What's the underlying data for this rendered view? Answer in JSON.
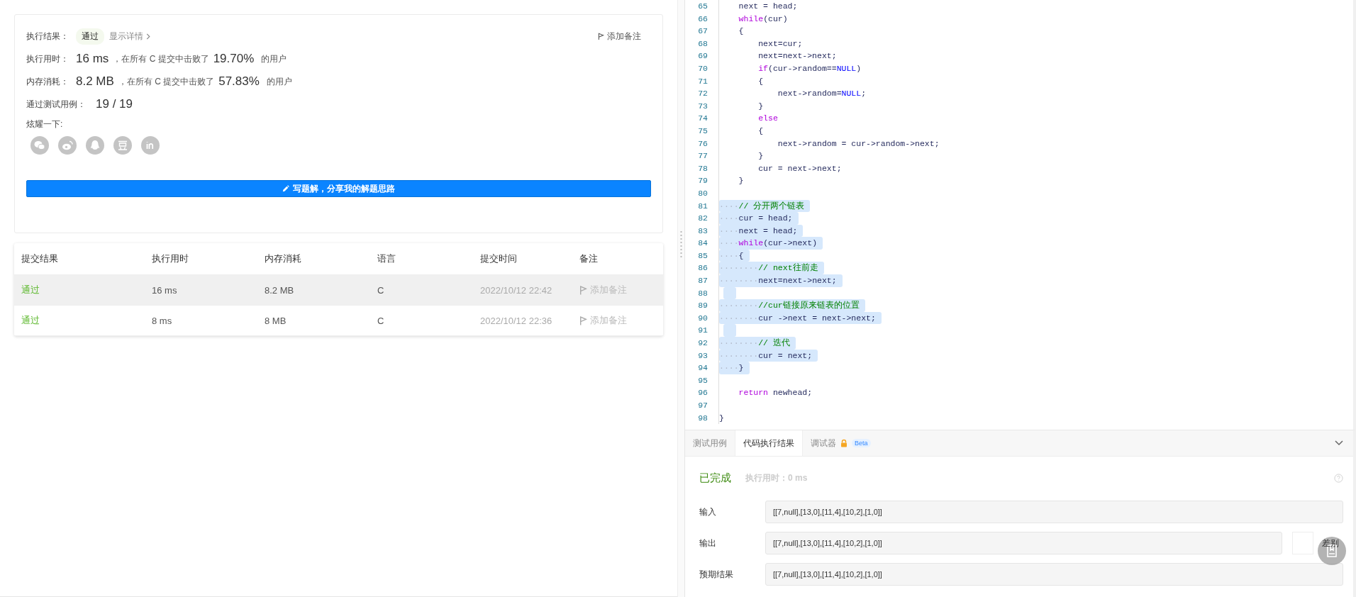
{
  "result": {
    "label": "执行结果：",
    "status": "通过",
    "details_link": "显示详情",
    "add_note": "添加备注"
  },
  "stats": [
    {
      "label": "执行用时：",
      "value": "16 ms",
      "note": "，在所有 C 提交中击败了",
      "percent": "19.70%",
      "suffix": "的用户"
    },
    {
      "label": "内存消耗：",
      "value": "8.2 MB",
      "note": "，在所有 C 提交中击败了",
      "percent": "57.83%",
      "suffix": "的用户"
    }
  ],
  "testcases": {
    "label": "通过测试用例：",
    "value": "19 / 19"
  },
  "share": {
    "label": "炫耀一下:"
  },
  "write_button": "写题解，分享我的解题思路",
  "submissions": {
    "columns": [
      "提交结果",
      "执行用时",
      "内存消耗",
      "语言",
      "提交时间",
      "备注"
    ],
    "rows": [
      {
        "status": "通过",
        "time": "16 ms",
        "memory": "8.2 MB",
        "language": "C",
        "submitted": "2022/10/12 22:42",
        "note": "添加备注",
        "selected": true
      },
      {
        "status": "通过",
        "time": "8 ms",
        "memory": "8 MB",
        "language": "C",
        "submitted": "2022/10/12 22:36",
        "note": "添加备注",
        "selected": false
      }
    ]
  },
  "editor": {
    "lines": [
      {
        "n": "65",
        "selected": false,
        "tokens": [
          {
            "t": "    next = head;",
            "kind": "plain"
          }
        ]
      },
      {
        "n": "66",
        "selected": false,
        "tokens": [
          {
            "t": "    while",
            "kind": "kw"
          },
          {
            "t": "(cur)",
            "kind": "plain"
          }
        ]
      },
      {
        "n": "67",
        "selected": false,
        "tokens": [
          {
            "t": "    {",
            "kind": "plain"
          }
        ]
      },
      {
        "n": "68",
        "selected": false,
        "tokens": [
          {
            "t": "        next=cur;",
            "kind": "plain"
          }
        ]
      },
      {
        "n": "69",
        "selected": false,
        "tokens": [
          {
            "t": "        next=next->next;",
            "kind": "plain"
          }
        ]
      },
      {
        "n": "70",
        "selected": false,
        "tokens": [
          {
            "t": "        if",
            "kind": "kw"
          },
          {
            "t": "(cur->random==",
            "kind": "plain"
          },
          {
            "t": "NULL",
            "kind": "const"
          },
          {
            "t": ")",
            "kind": "plain"
          }
        ]
      },
      {
        "n": "71",
        "selected": false,
        "tokens": [
          {
            "t": "        {",
            "kind": "plain"
          }
        ]
      },
      {
        "n": "72",
        "selected": false,
        "tokens": [
          {
            "t": "            next->random=",
            "kind": "plain"
          },
          {
            "t": "NULL",
            "kind": "const"
          },
          {
            "t": ";",
            "kind": "plain"
          }
        ]
      },
      {
        "n": "73",
        "selected": false,
        "tokens": [
          {
            "t": "        }",
            "kind": "plain"
          }
        ]
      },
      {
        "n": "74",
        "selected": false,
        "tokens": [
          {
            "t": "        else",
            "kind": "kw"
          }
        ]
      },
      {
        "n": "75",
        "selected": false,
        "tokens": [
          {
            "t": "        {",
            "kind": "plain"
          }
        ]
      },
      {
        "n": "76",
        "selected": false,
        "tokens": [
          {
            "t": "            next->random = cur->random->next;",
            "kind": "plain"
          }
        ]
      },
      {
        "n": "77",
        "selected": false,
        "tokens": [
          {
            "t": "        }",
            "kind": "plain"
          }
        ]
      },
      {
        "n": "78",
        "selected": false,
        "tokens": [
          {
            "t": "        cur = next->next;",
            "kind": "plain"
          }
        ]
      },
      {
        "n": "79",
        "selected": false,
        "tokens": [
          {
            "t": "    }",
            "kind": "plain"
          }
        ]
      },
      {
        "n": "80",
        "selected": false
      },
      {
        "n": "81",
        "selected": true,
        "tokens": [
          {
            "t": "····",
            "kind": "ws"
          },
          {
            "t": "// 分开两个链表",
            "kind": "comment"
          }
        ]
      },
      {
        "n": "82",
        "selected": true,
        "tokens": [
          {
            "t": "····",
            "kind": "ws"
          },
          {
            "t": "cur = head;",
            "kind": "plain"
          }
        ]
      },
      {
        "n": "83",
        "selected": true,
        "tokens": [
          {
            "t": "····",
            "kind": "ws"
          },
          {
            "t": "next = head;",
            "kind": "plain"
          }
        ]
      },
      {
        "n": "84",
        "selected": true,
        "tokens": [
          {
            "t": "····",
            "kind": "ws"
          },
          {
            "t": "while",
            "kind": "kw"
          },
          {
            "t": "(cur->next)",
            "kind": "plain"
          }
        ]
      },
      {
        "n": "85",
        "selected": true,
        "tokens": [
          {
            "t": "····",
            "kind": "ws"
          },
          {
            "t": "{",
            "kind": "plain"
          }
        ]
      },
      {
        "n": "86",
        "selected": true,
        "tokens": [
          {
            "t": "········",
            "kind": "ws"
          },
          {
            "t": "// next往前走",
            "kind": "comment"
          }
        ]
      },
      {
        "n": "87",
        "selected": true,
        "tokens": [
          {
            "t": "········",
            "kind": "ws"
          },
          {
            "t": "next=next->next;",
            "kind": "plain"
          }
        ]
      },
      {
        "n": "88",
        "selected": true
      },
      {
        "n": "89",
        "selected": true,
        "tokens": [
          {
            "t": "········",
            "kind": "ws"
          },
          {
            "t": "//cur链接原来链表的位置",
            "kind": "comment"
          }
        ]
      },
      {
        "n": "90",
        "selected": true,
        "tokens": [
          {
            "t": "········",
            "kind": "ws"
          },
          {
            "t": "cur ->next = next->next;",
            "kind": "plain"
          }
        ]
      },
      {
        "n": "91",
        "selected": true
      },
      {
        "n": "92",
        "selected": true,
        "tokens": [
          {
            "t": "········",
            "kind": "ws"
          },
          {
            "t": "// 迭代",
            "kind": "comment"
          }
        ]
      },
      {
        "n": "93",
        "selected": true,
        "tokens": [
          {
            "t": "········",
            "kind": "ws"
          },
          {
            "t": "cur = next;",
            "kind": "plain"
          }
        ]
      },
      {
        "n": "94",
        "selected": true,
        "tokens": [
          {
            "t": "····",
            "kind": "ws"
          },
          {
            "t": "}",
            "kind": "plain"
          }
        ]
      },
      {
        "n": "95",
        "selected": false
      },
      {
        "n": "96",
        "selected": false,
        "tokens": [
          {
            "t": "    return",
            "kind": "kw"
          },
          {
            "t": " newhead;",
            "kind": "plain"
          }
        ]
      },
      {
        "n": "97",
        "selected": false
      },
      {
        "n": "98",
        "selected": false,
        "tokens": [
          {
            "t": "}",
            "kind": "plain"
          }
        ]
      }
    ]
  },
  "console": {
    "tabs": [
      {
        "label": "测试用例",
        "selected": false
      },
      {
        "label": "代码执行结果",
        "selected": true
      },
      {
        "label": "调试器",
        "selected": false,
        "locked": true,
        "badge": "Beta"
      }
    ],
    "status": "已完成",
    "time": "执行用时：0 ms",
    "rows": [
      {
        "label": "输入",
        "value": "[[7,null],[13,0],[11,4],[10,2],[1,0]]"
      },
      {
        "label": "输出",
        "value": "[[7,null],[13,0],[11,4],[10,2],[1,0]]",
        "diff": "差别"
      },
      {
        "label": "预期结果",
        "value": "[[7,null],[13,0],[11,4],[10,2],[1,0]]"
      }
    ]
  }
}
